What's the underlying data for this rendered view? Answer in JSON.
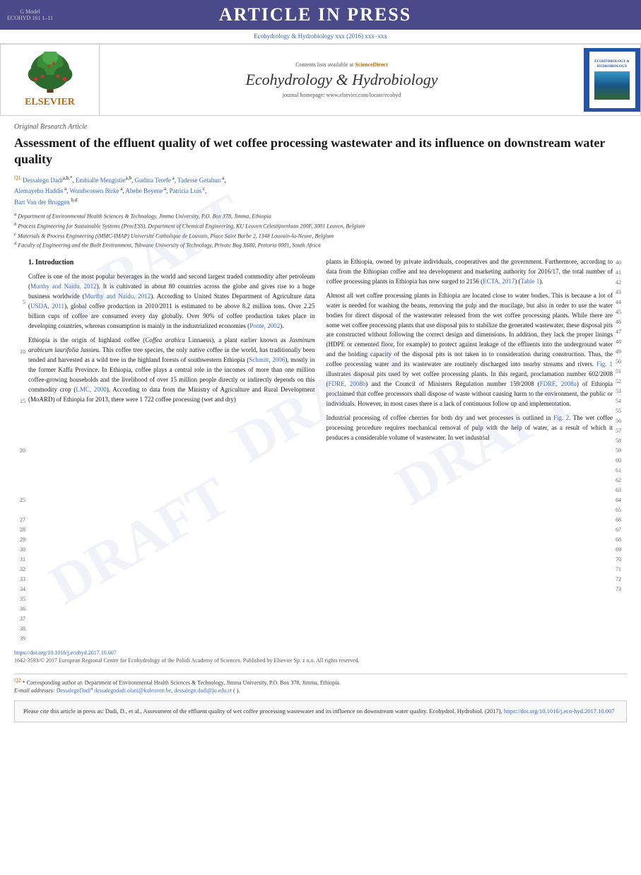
{
  "topBanner": {
    "gModel": "G Model",
    "ecohydRef": "ECOHYD 161 1–11",
    "articleInPress": "ARTICLE IN PRESS",
    "journalUrl": "Ecohydrology & Hydrobiology xxx (2016) xxx–xxx"
  },
  "journalHeader": {
    "contentsListText": "Contents lists available at",
    "scienceDirectLink": "ScienceDirect",
    "journalName": "Ecohydrology & Hydrobiology",
    "homepageText": "journal homepage: www.elsevier.com/locate/ecohyd",
    "elsevierText": "ELSEVIER",
    "coverTitle": "ECOHYDROLOGY & HYDROBIOLOGY"
  },
  "article": {
    "type": "Original Research Article",
    "title": "Assessment of the effluent quality of wet coffee processing wastewater and its influence on downstream water quality",
    "authors": "Dessalegn Dadi a,b,*, Embialle Mengistie a,b, Gudina Terefe a, Tadesse Getahun a, Alemayehu Haddis a, Wondwossen Birke a, Abebe Beyene a, Patricia Luis c, Bart Van der Bruggen b,d",
    "affiliations": [
      "a Department of Environmental Health Sciences & Technology, Jimma University, P.O. Box 378, Jimma, Ethiopia",
      "b Process Engineering for Sustainable Systems (ProcESS), Department of Chemical Engineering, KU Leuven Celestijnenlaan 200F, 3001 Leuven, Belgium",
      "c Materials & Process Engineering (iMMC-IMAP) Université Catholique de Louvain, Place Saint Barbe 2, 1348 Louvain-la-Neuve, Belgium",
      "d Faculty of Engineering and the Built Environment, Tshwane University of Technology, Private Bag X680, Pretoria 0001, South Africa"
    ]
  },
  "introduction": {
    "title": "1. Introduction",
    "leftColumn": "Coffee is one of the most popular beverages in the world and second largest traded commodity after petroleum (Murthy and Naidu, 2012). It is cultivated in about 80 countries across the globe and gives rise to a huge business worldwide (Murthy and Naidu, 2012). According to United States Department of Agriculture data (USDA, 2011), global coffee production in 2010/2011 is estimated to be above 8.2 million tons. Over 2.25 billion cups of coffee are consumed every day globally. Over 90% of coffee production takes place in developing countries, whereas consumption is mainly in the industrialized economies (Ponte, 2002).\n\nEthiopia is the origin of highland coffee (Coffea arabica Linnaeus), a plant earlier known as Jasminum arabicum laurifolia Jussieu. This coffee tree species, the only native coffee in the world, has traditionally been tended and harvested as a wild tree in the highland forests of southwestern Ethiopia (Schmitt, 2006), mostly in the former Kaffa Province. In Ethiopia, coffee plays a central role in the incomes of more than one million coffee-growing households and the livelihood of over 15 million people directly or indirectly depends on this commodity crop (LMC, 2000). According to data from the Ministry of Agriculture and Rural Development (MoARD) of Ethiopia for 2013, there were 1 722 coffee processing (wet and dry)",
    "rightColumn": "plants in Ethiopia, owned by private individuals, cooperatives and the government. Furthermore, according to data from the Ethiopian coffee and tea development and marketing authority for 2016/17, the total number of coffee processing plants in Ethiopia has now surged to 2156 (ECTA, 2017) (Table 1).\n\nAlmost all wet coffee processing plants in Ethiopia are located close to water bodies. This is because a lot of water is needed for washing the beans, removing the pulp and the mucilage, but also in order to use the water bodies for direct disposal of the wastewater released from the wet coffee processing plants. While there are some wet coffee processing plants that use disposal pits to stabilize the generated wastewater, these disposal pits are constructed without following the correct design and dimensions. In addition, they lack the proper linings (HDPE or cemented floor, for example) to protect against leakage of the effluents into the underground water and the holding capacity of the disposal pits is not taken in to consideration during construction. Thus, the coffee processing water and its wastewater are routinely discharged into nearby streams and rivers. Fig. 1 illustrates disposal pits used by wet coffee processing plants. In this regard, proclamation number 602/2008 (FDRE, 2008b) and the Council of Ministers Regulation number 159/2008 (FDRE, 2008a) of Ethiopia proclaimed that coffee processors shall dispose of waste without causing harm to the environment, the public or individuals. However, in most cases there is a lack of continuous follow up and implementation.\n\nIndustrial processing of coffee cherries for both dry and wet processes is outlined in Fig. 2. The wet coffee processing procedure requires mechanical removal of pulp with the help of water, as a result of which it produces a considerable volume of wastewater. In wet industrial"
  },
  "lineNumbers": {
    "left": [
      "",
      "",
      "",
      "",
      "5",
      "",
      "",
      "",
      "",
      "10",
      "",
      "",
      "",
      "",
      "15",
      "",
      "",
      "",
      "",
      "20",
      "",
      "",
      "",
      "",
      "25",
      "",
      "",
      "27",
      "28",
      "29",
      "30",
      "31",
      "32",
      "33",
      "34",
      "35",
      "36",
      "37",
      "38",
      "39"
    ],
    "right": [
      "40",
      "41",
      "42",
      "43",
      "44",
      "45",
      "46",
      "47",
      "48",
      "49",
      "50",
      "51",
      "52",
      "53",
      "54",
      "55",
      "56",
      "57",
      "58",
      "59",
      "60",
      "61",
      "62",
      "63",
      "64",
      "65",
      "66",
      "67",
      "68",
      "69",
      "70",
      "71",
      "72",
      "73"
    ]
  },
  "footnotes": {
    "correspondingNote": "* Corresponding author at: Department of Environmental Health Sciences & Technology, Jimma University, P.O. Box 378, Jimma, Ethiopia.",
    "emailLabel": "E-mail addresses:",
    "emails": "DessalegnDadi@dessalegndadi.olani@kuleuven-he\">DessalegnDadi@dessalegndadi.olani@kuleuven.be, dessalegn.dadi@ju.edu.et\">dessalegn.dadi@ju.edu.et (  ).",
    "q2marker": "Q2"
  },
  "doi": {
    "doiText": "https://doi.org/10.1016/j.ecohyd.2017.10.007",
    "copyright": "1642-3593/© 2017 European Regional Centre for Ecohydrology of the Polish Academy of Sciences. Published by Elsevier Sp. z o.o. All rights reserved."
  },
  "citation": {
    "text": "Please cite this article in press as: Dadi, D., et al., Assessment of the effluent quality of wet coffee processing wastewater and its influence on downstream water quality. Ecohydrol. Hydrobiol. (2017),",
    "link": "https://doi.org/10.1016/j.eco-hyd.2017.10.007"
  }
}
